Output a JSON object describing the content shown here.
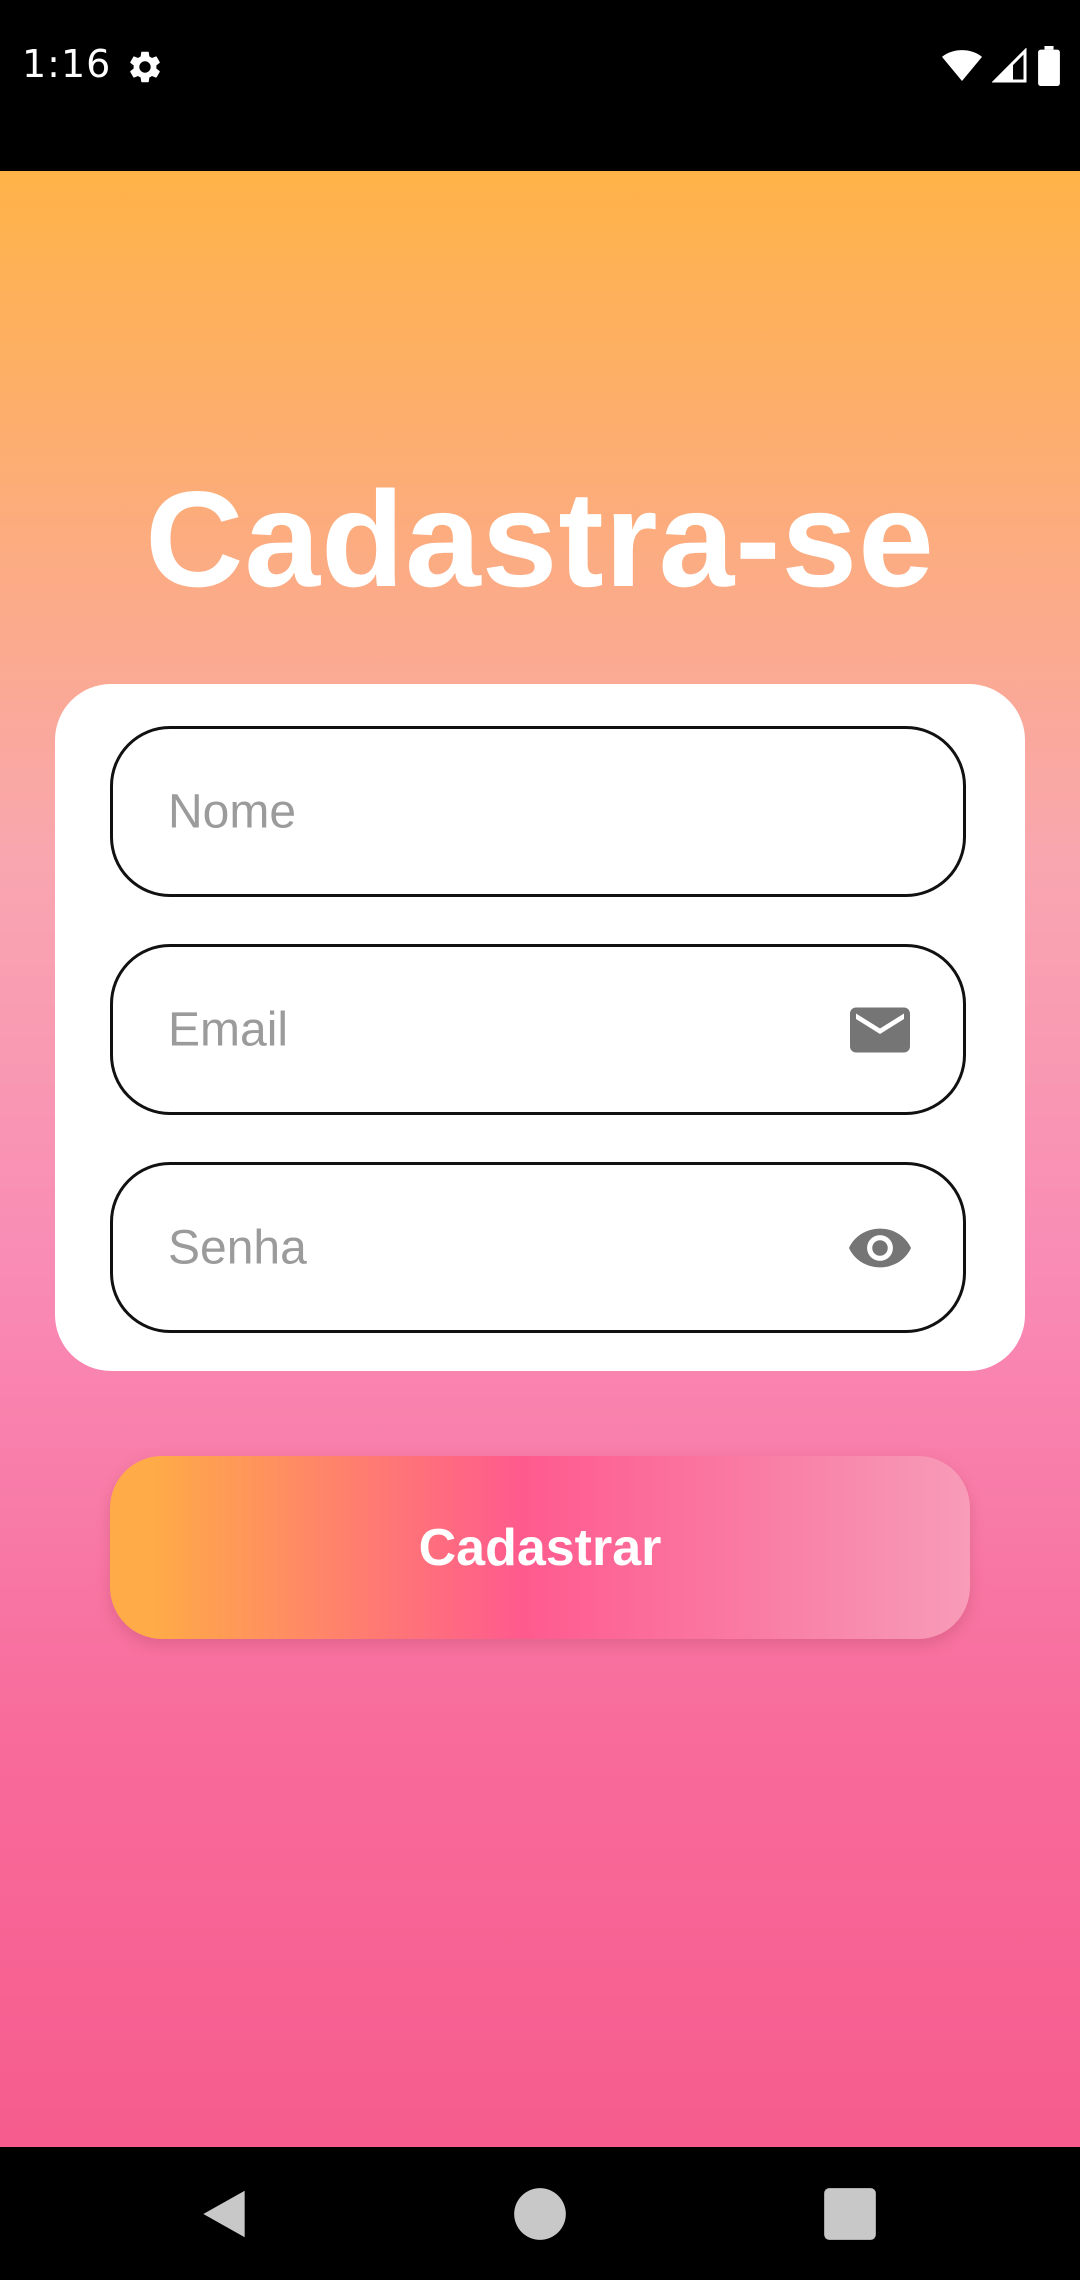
{
  "status_bar": {
    "time": "1:16",
    "icons": [
      "gear-icon",
      "wifi-icon",
      "signal-icon",
      "battery-icon"
    ]
  },
  "screen": {
    "title": "Cadastra-se",
    "fields": {
      "name_placeholder": "Nome",
      "email_placeholder": "Email",
      "email_icon": "mail-icon",
      "password_placeholder": "Senha",
      "password_icon": "eye-icon"
    },
    "submit_label": "Cadastrar"
  },
  "nav_bar": {
    "buttons": [
      "back-icon",
      "home-icon",
      "recents-icon"
    ]
  },
  "colors": {
    "gradient_top": "#ffb347",
    "gradient_bottom": "#f65c8e",
    "button_start": "#ffab47",
    "button_mid": "#ff5a8e",
    "button_end": "#f89cb8",
    "field_border": "#111111",
    "placeholder": "#9b9b9b",
    "icon_gray": "#777777"
  }
}
